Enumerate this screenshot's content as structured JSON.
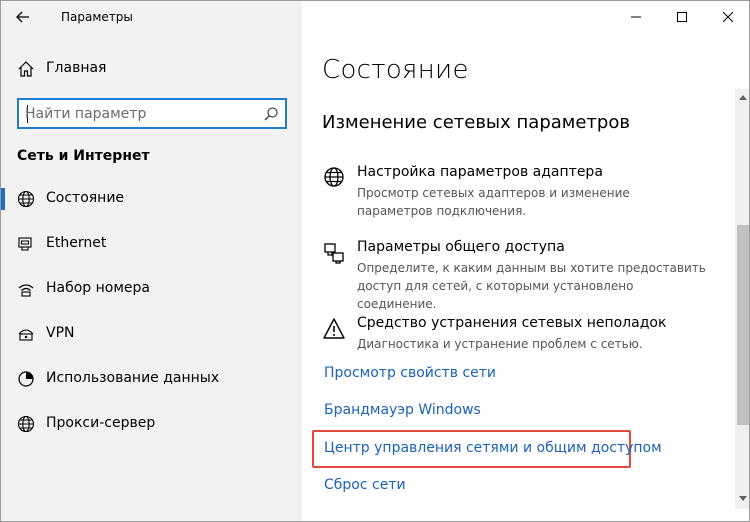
{
  "window": {
    "title": "Параметры"
  },
  "sidebar": {
    "home_label": "Главная",
    "search_placeholder": "Найти параметр",
    "section_title": "Сеть и Интернет",
    "items": [
      {
        "label": "Состояние",
        "icon": "globe-icon",
        "selected": true
      },
      {
        "label": "Ethernet",
        "icon": "ethernet-icon",
        "selected": false
      },
      {
        "label": "Набор номера",
        "icon": "dialup-icon",
        "selected": false
      },
      {
        "label": "VPN",
        "icon": "vpn-icon",
        "selected": false
      },
      {
        "label": "Использование данных",
        "icon": "data-usage-icon",
        "selected": false
      },
      {
        "label": "Прокси-сервер",
        "icon": "globe-icon",
        "selected": false
      }
    ]
  },
  "content": {
    "title": "Состояние",
    "subtitle": "Изменение сетевых параметров",
    "settings": [
      {
        "name": "Настройка параметров адаптера",
        "desc": "Просмотр сетевых адаптеров и изменение параметров подключения.",
        "icon": "adapter-globe-icon"
      },
      {
        "name": "Параметры общего доступа",
        "desc": "Определите, к каким данным вы хотите предоставить доступ для сетей, с которыми установлено соединение.",
        "icon": "sharing-icon"
      },
      {
        "name": "Средство устранения сетевых неполадок",
        "desc": "Диагностика и устранение проблем с сетью.",
        "icon": "warning-icon"
      }
    ],
    "links": [
      "Просмотр свойств сети",
      "Брандмауэр Windows",
      "Центр управления сетями и общим доступом",
      "Сброс сети"
    ]
  },
  "colors": {
    "accent": "#1f7ed0",
    "link": "#1a63b8",
    "highlight_border": "#e2483d",
    "sidebar_bg": "#f2f2f2"
  }
}
